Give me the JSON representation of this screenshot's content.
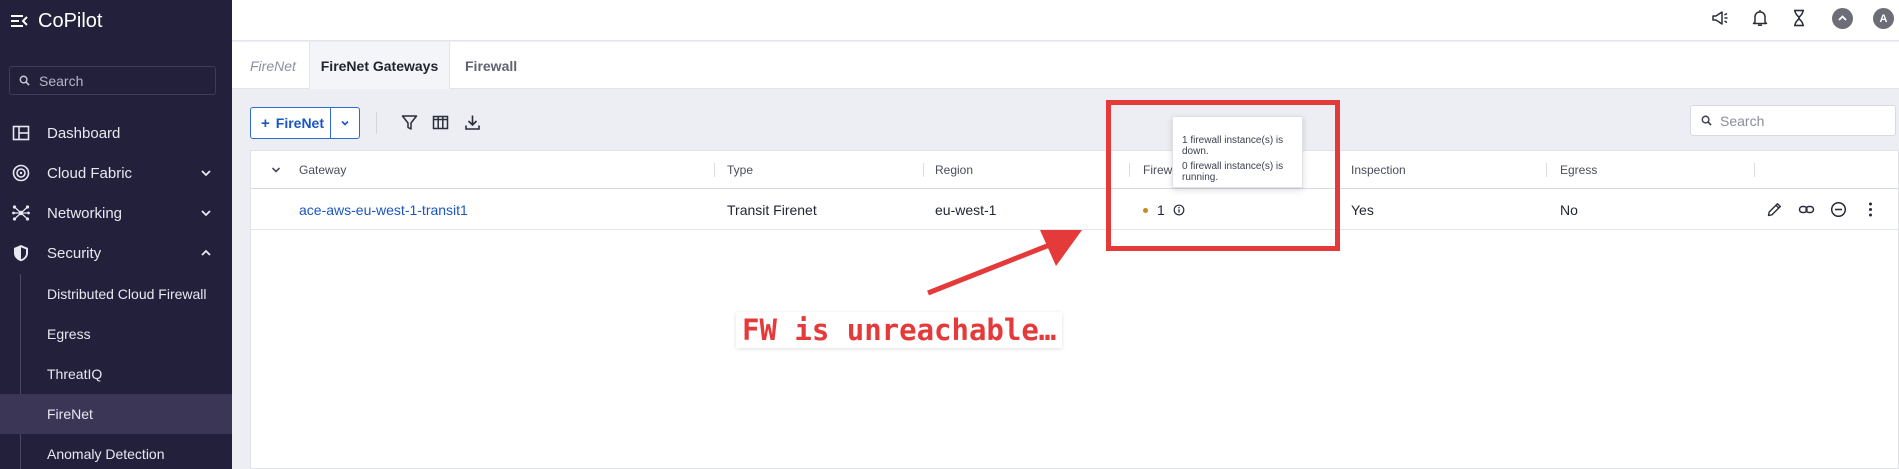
{
  "app": {
    "name": "CoPilot"
  },
  "sidebar": {
    "search_placeholder": "Search",
    "items": [
      {
        "label": "Dashboard"
      },
      {
        "label": "Cloud Fabric"
      },
      {
        "label": "Networking"
      },
      {
        "label": "Security"
      }
    ],
    "security_subitems": [
      {
        "label": "Distributed Cloud Firewall"
      },
      {
        "label": "Egress"
      },
      {
        "label": "ThreatIQ"
      },
      {
        "label": "FireNet",
        "active": true
      },
      {
        "label": "Anomaly Detection"
      }
    ]
  },
  "topbar": {
    "icons": [
      "megaphone-icon",
      "bell-icon",
      "hourglass-icon",
      "up-arrow-icon"
    ],
    "avatar_initial": "A"
  },
  "tabs": [
    {
      "label": "FireNet"
    },
    {
      "label": "FireNet Gateways",
      "active": true
    },
    {
      "label": "Firewall"
    }
  ],
  "toolbar": {
    "add_button_label": "FireNet",
    "add_button_plus": "+",
    "icons": [
      "filter-icon",
      "columns-icon",
      "download-icon"
    ],
    "search_placeholder": "Search"
  },
  "table": {
    "columns": [
      "Gateway",
      "Type",
      "Region",
      "Firew",
      "Inspection",
      "Egress"
    ],
    "rows": [
      {
        "gateway": "ace-aws-eu-west-1-transit1",
        "type": "Transit Firenet",
        "region": "eu-west-1",
        "firewall_count": "1",
        "inspection": "Yes",
        "egress": "No"
      }
    ]
  },
  "tooltip": {
    "line1": "1 firewall instance(s) is down.",
    "line2": "0 firewall instance(s) is running."
  },
  "annotation": {
    "label": "FW is unreachable…",
    "color": "#e43a3a"
  },
  "colors": {
    "sidebar_bg": "#22203a",
    "accent": "#1a56c4",
    "status_warning": "#c08a1e"
  }
}
